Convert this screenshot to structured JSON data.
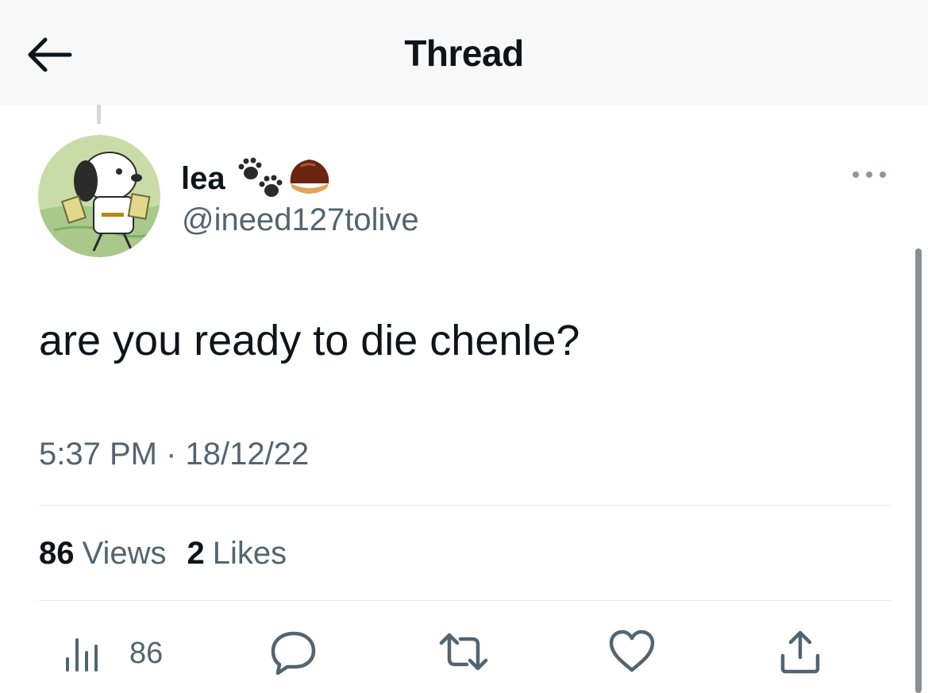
{
  "header": {
    "title": "Thread",
    "back_icon": "arrow-left-icon"
  },
  "tweet": {
    "author": {
      "display_name": "lea",
      "name_emojis": [
        "paw-prints-icon",
        "chestnut-icon"
      ],
      "handle": "@ineed127tolive",
      "avatar": "snoopy-avatar"
    },
    "text": "are you ready to die chenle?",
    "timestamp": "5:37 PM · 18/12/22",
    "stats": {
      "views_count": "86",
      "views_label": "Views",
      "likes_count": "2",
      "likes_label": "Likes"
    }
  },
  "actions": {
    "views": {
      "icon": "bar-chart-icon",
      "count": "86"
    },
    "reply": {
      "icon": "reply-icon"
    },
    "retweet": {
      "icon": "retweet-icon"
    },
    "like": {
      "icon": "heart-icon"
    },
    "share": {
      "icon": "share-icon"
    }
  },
  "colors": {
    "text_primary": "#0f1419",
    "text_secondary": "#536471",
    "divider": "#e6e9eb",
    "header_bg": "#f8f8f8"
  }
}
